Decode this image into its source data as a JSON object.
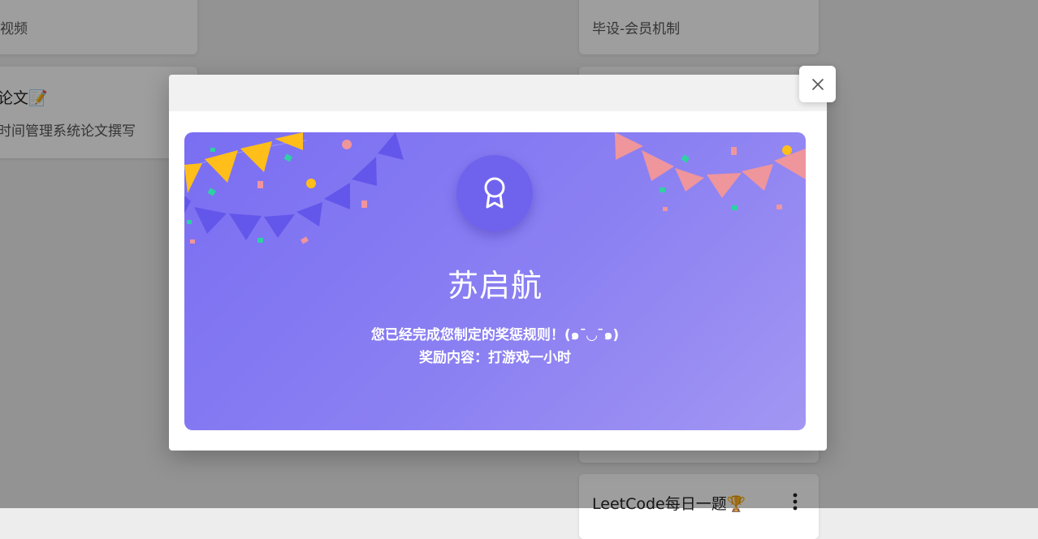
{
  "background_cards": [
    {
      "id": "c1",
      "title": "",
      "subtitle": "视频"
    },
    {
      "id": "c2",
      "title": "论文📝",
      "subtitle": "时间管理系统论文撰写"
    },
    {
      "id": "c3",
      "title": "",
      "subtitle": "毕设-会员机制"
    },
    {
      "id": "c4",
      "title": "LeetCode每日一题🏆",
      "subtitle": ""
    }
  ],
  "dialog": {
    "close_icon": "close-icon",
    "badge_icon": "award-ribbon-icon",
    "name": "苏启航",
    "message": "您已经完成您制定的奖惩规则！(๑¯◡¯๑)",
    "reward": "奖励内容：打游戏一小时"
  },
  "colors": {
    "banner_start": "#7a6ef2",
    "banner_end": "#a296f3",
    "badge": "#6f63ee",
    "flag_yellow": "#ffbe1a",
    "flag_purple": "#6356ea",
    "flag_pink": "#ef959c"
  }
}
